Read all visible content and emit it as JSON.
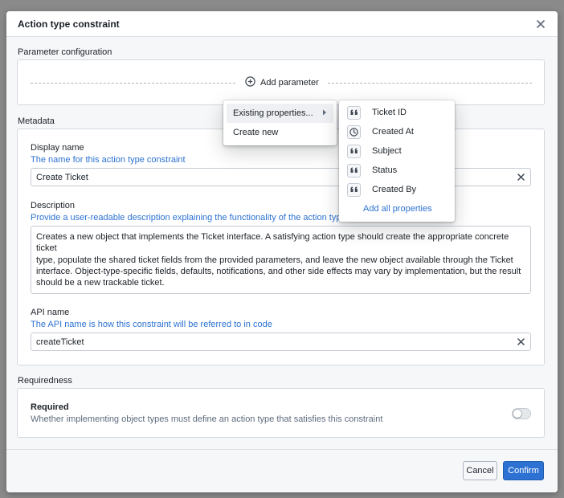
{
  "dialog": {
    "title": "Action type constraint"
  },
  "parameter_configuration": {
    "label": "Parameter configuration",
    "add_parameter_label": "Add parameter"
  },
  "metadata": {
    "label": "Metadata",
    "display_name": {
      "label": "Display name",
      "help": "The name for this action type constraint",
      "value": "Create Ticket"
    },
    "description": {
      "label": "Description",
      "help": "Provide a user-readable description explaining the functionality of the action type",
      "lines": [
        "Creates a new object that implements the Ticket interface. A satisfying action type should create the appropriate concrete ticket",
        "type, populate the shared ticket fields from the provided parameters, and leave the new object available through the Ticket",
        "interface. Object-type-specific fields, defaults, notifications, and other side effects may vary by implementation, but the result",
        "should be a new trackable ticket."
      ]
    },
    "api_name": {
      "label": "API name",
      "help": "The API name is how this constraint will be referred to in code",
      "value": "createTicket"
    }
  },
  "requiredness": {
    "label": "Requiredness",
    "title": "Required",
    "help": "Whether implementing object types must define an action type that satisfies this constraint",
    "enabled": false
  },
  "add_parameter_menu": {
    "items": [
      {
        "label": "Existing properties...",
        "has_submenu": true,
        "active": true
      },
      {
        "label": "Create new",
        "has_submenu": false,
        "active": false
      }
    ]
  },
  "properties_submenu": {
    "items": [
      {
        "label": "Ticket ID",
        "icon": "quote-icon"
      },
      {
        "label": "Created At",
        "icon": "clock-icon"
      },
      {
        "label": "Subject",
        "icon": "quote-icon"
      },
      {
        "label": "Status",
        "icon": "quote-icon"
      },
      {
        "label": "Created By",
        "icon": "quote-icon"
      }
    ],
    "add_all_label": "Add all properties"
  },
  "footer": {
    "cancel_label": "Cancel",
    "confirm_label": "Confirm"
  },
  "colors": {
    "primary": "#2d72d2",
    "help_text": "#2d72d2",
    "backdrop": "#8a8a8a"
  }
}
